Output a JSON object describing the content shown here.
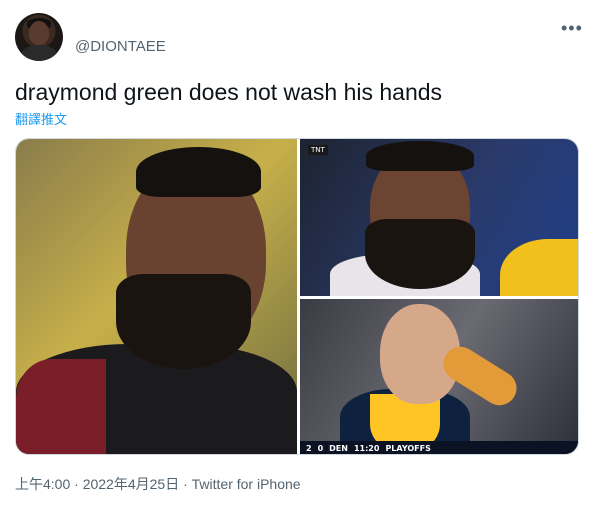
{
  "tweet": {
    "handle": "@DIONTAEE",
    "text": "draymond green does not wash his hands",
    "translate_label": "翻譯推文",
    "timestamp": "上午4:00 · 2022年4月25日 · ",
    "source": "Twitter for iPhone"
  },
  "media": {
    "photo3_scorebar": {
      "left_score": "2",
      "right_score": "0",
      "right_team": "DEN",
      "clock": "11:20",
      "tag": "PLAYOFFS"
    }
  },
  "icons": {
    "more": "more-options-icon"
  }
}
